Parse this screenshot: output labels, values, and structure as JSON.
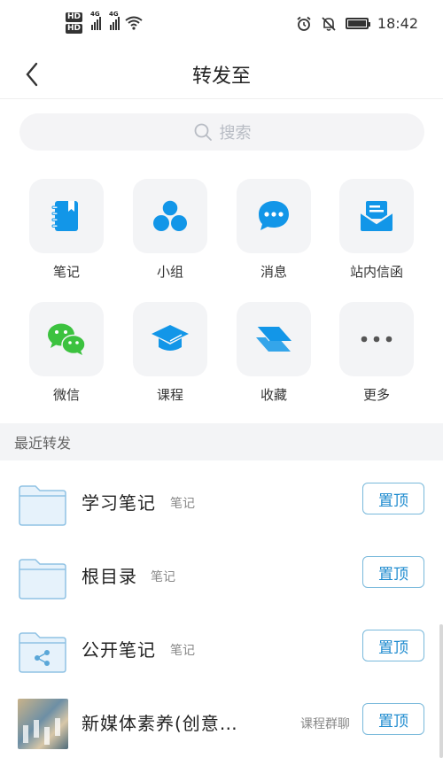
{
  "status": {
    "network": [
      "HD",
      "HD"
    ],
    "sig_label_1": "4G",
    "sig_label_2": "4G",
    "time": "18:42"
  },
  "header": {
    "title": "转发至"
  },
  "search": {
    "placeholder": "搜索"
  },
  "grid": [
    {
      "label": "笔记",
      "icon": "notebook-icon"
    },
    {
      "label": "小组",
      "icon": "group-icon"
    },
    {
      "label": "消息",
      "icon": "message-icon"
    },
    {
      "label": "站内信函",
      "icon": "mail-icon"
    },
    {
      "label": "微信",
      "icon": "wechat-icon"
    },
    {
      "label": "课程",
      "icon": "course-icon"
    },
    {
      "label": "收藏",
      "icon": "favorites-icon"
    },
    {
      "label": "更多",
      "icon": "more-icon"
    }
  ],
  "section": {
    "title": "最近转发"
  },
  "recent": [
    {
      "name": "学习笔记",
      "tag": "笔记",
      "pin": "置顶",
      "icon": "folder-icon"
    },
    {
      "name": "根目录",
      "tag": "笔记",
      "pin": "置顶",
      "icon": "folder-icon"
    },
    {
      "name": "公开笔记",
      "tag": "笔记",
      "pin": "置顶",
      "icon": "shared-folder-icon"
    },
    {
      "name": "新媒体素养(创意…",
      "tag": "课程群聊",
      "pin": "置顶",
      "icon": "group-thumbnail"
    }
  ],
  "colors": {
    "accent": "#1e8bcf",
    "icon_blue": "#1296e8",
    "wechat_green": "#3cc23f"
  }
}
